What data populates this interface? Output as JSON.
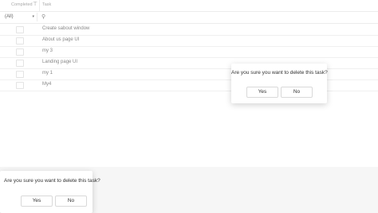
{
  "grid": {
    "header": {
      "completed_label": "Completed",
      "filter_icon": "filter-icon",
      "task_label": "Task"
    },
    "filter_row": {
      "select_value": "(All)",
      "caret_icon": "chevron-down-icon",
      "search_icon": "search-icon"
    },
    "rows": [
      {
        "task": "Create sabout window"
      },
      {
        "task": "About us page UI"
      },
      {
        "task": "my 3"
      },
      {
        "task": "Landing page UI"
      },
      {
        "task": "my 1"
      },
      {
        "task": "My4"
      }
    ]
  },
  "confirm_popup_1": {
    "message": "Are you sure you want to delete this task?",
    "yes_label": "Yes",
    "no_label": "No"
  },
  "confirm_popup_2": {
    "message": "Are you sure you want to delete this task?",
    "yes_label": "Yes",
    "no_label": "No"
  }
}
